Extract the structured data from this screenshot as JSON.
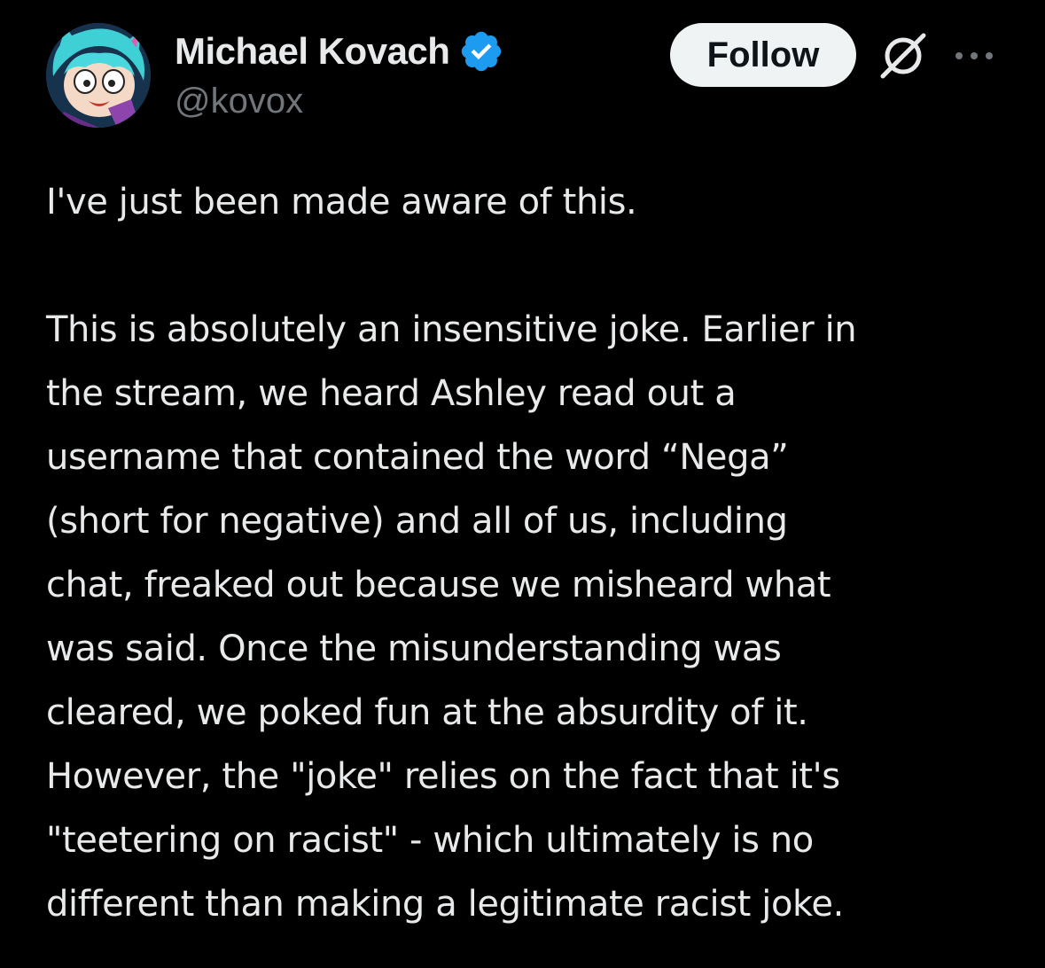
{
  "author": {
    "display_name": "Michael Kovach",
    "handle": "@kovox",
    "verified_icon": "verified-badge-icon",
    "verified_color": "#1d9bf0",
    "avatar_icon": "avatar-cartoon-character"
  },
  "actions": {
    "follow_label": "Follow",
    "grok_icon": "grok-icon",
    "more_icon": "more-options-icon"
  },
  "post": {
    "paragraph1": "I've just been made aware of this.",
    "lines": [
      "This is absolutely an insensitive joke. Earlier in",
      "the stream, we heard Ashley read out a",
      "username that contained the word “Nega”",
      "(short for negative) and all of us, including",
      "chat, freaked out because we misheard what",
      "was said. Once the misunderstanding was",
      "cleared, we poked fun at the absurdity of it.",
      "However, the \"joke\" relies on the fact that it's",
      "\"teetering on racist\" - which ultimately is no",
      "different than making a legitimate racist joke."
    ]
  },
  "colors": {
    "background": "#000000",
    "text_primary": "#e7e9ea",
    "text_secondary": "#71767b",
    "follow_bg": "#eff3f4",
    "follow_text": "#0f1419"
  }
}
